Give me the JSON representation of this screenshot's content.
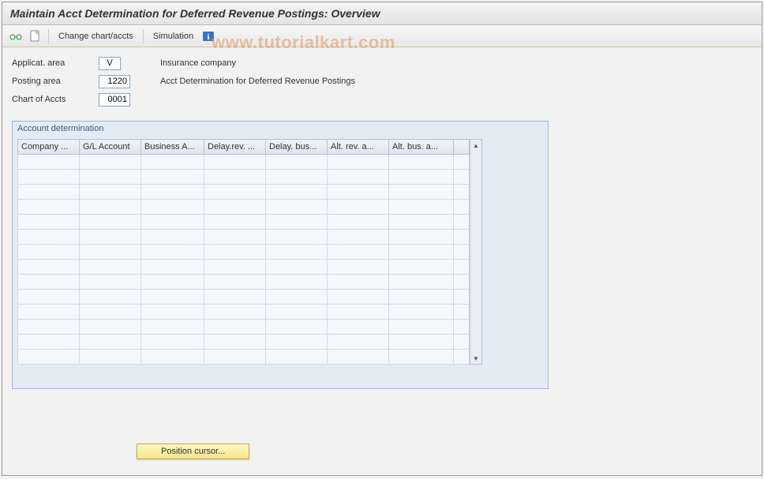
{
  "title": "Maintain Acct Determination for Deferred Revenue Postings: Overview",
  "watermark": "www.tutorialkart.com",
  "toolbar": {
    "change_chart_label": "Change chart/accts",
    "simulation_label": "Simulation"
  },
  "header": {
    "applicat_area": {
      "label": "Applicat. area",
      "value": "V",
      "desc": "Insurance company"
    },
    "posting_area": {
      "label": "Posting area",
      "value": "1220",
      "desc": "Acct Determination for Deferred Revenue Postings"
    },
    "chart_of_accts": {
      "label": "Chart of Accts",
      "value": "0001",
      "desc": ""
    }
  },
  "panel": {
    "title": "Account determination",
    "columns": [
      "Company ...",
      "G/L Account",
      "Business A...",
      "Delay.rev. ...",
      "Delay. bus...",
      "Alt. rev. a...",
      "Alt. bus. a..."
    ]
  },
  "position_button": "Position cursor..."
}
